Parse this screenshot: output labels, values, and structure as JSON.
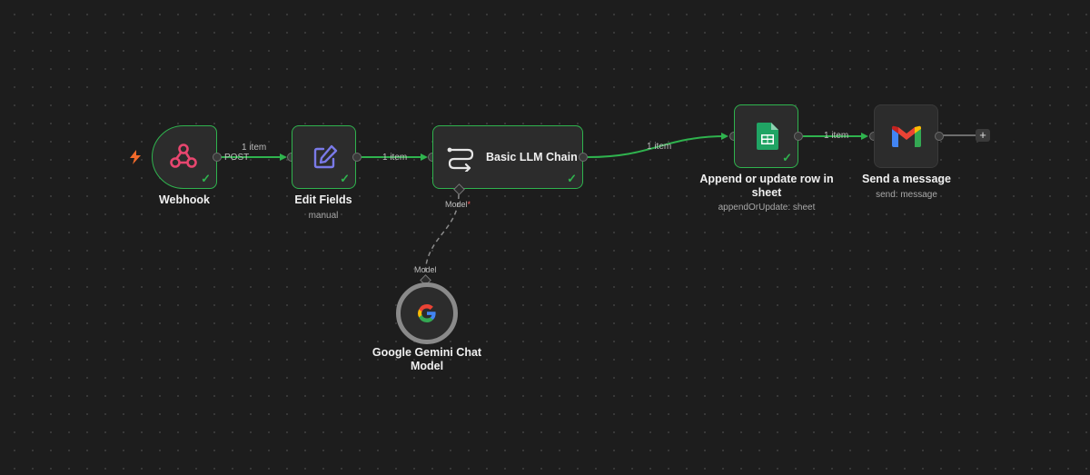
{
  "nodes": {
    "webhook": {
      "label": "Webhook"
    },
    "edit_fields": {
      "label": "Edit Fields",
      "subtitle": "manual"
    },
    "llm_chain": {
      "label": "Basic LLM Chain",
      "model_port": "Model",
      "required_mark": "*"
    },
    "sheets": {
      "label_line1": "Append or update row in",
      "label_line2": "sheet",
      "subtitle": "appendOrUpdate: sheet"
    },
    "gmail": {
      "label": "Send a message",
      "subtitle": "send: message"
    },
    "gemini": {
      "label_line1": "Google Gemini Chat",
      "label_line2": "Model",
      "port": "Model"
    }
  },
  "edges": {
    "webhook_method": "POST",
    "webhook_to_edit": "1 item",
    "edit_to_llm": "1 item",
    "llm_to_sheets": "1 item",
    "sheets_to_gmail": "1 item"
  },
  "add_button": "+",
  "check_mark": "✓",
  "colors": {
    "success": "#2fb34e",
    "webhook_icon": "#e8466f",
    "edit_icon": "#7a7ae8",
    "trigger_bolt": "#f26a2a",
    "canvas": "#1d1d1d"
  },
  "icons": [
    "webhook-icon",
    "pencil-edit-icon",
    "llm-chain-icon",
    "google-sheets-icon",
    "gmail-icon",
    "google-g-icon",
    "lightning-bolt-icon"
  ]
}
